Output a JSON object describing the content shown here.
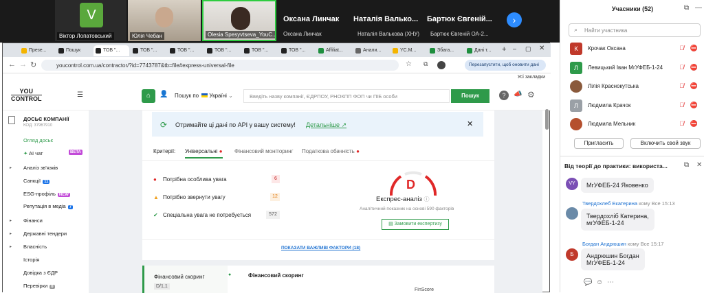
{
  "zoom": {
    "tiles": [
      {
        "initial": "V",
        "name": "Віктор Лопатовський"
      },
      {
        "name": "Юлія Чебан"
      },
      {
        "name": "Olesia Spesyvtseva_YouC..."
      }
    ],
    "name_tiles": [
      {
        "big": "Оксана Линчак",
        "small": "Оксана Линчак"
      },
      {
        "big": "Наталія Валько...",
        "small": "Наталія Валькова (ХНУ)"
      },
      {
        "big": "Бартюк Євгеній...",
        "small": "Бартюк Євгеній ОА-2..."
      }
    ],
    "next_icon": "chevron-right-icon"
  },
  "browser": {
    "tabs": [
      "Презе...",
      "Пошук",
      "ТОВ \"...",
      "ТОВ \"...",
      "ТОВ \"...",
      "ТОВ \"...",
      "ТОВ \"...",
      "ТОВ \"...",
      "Affiliat...",
      "Анали...",
      "YC.M...",
      "Збага...",
      "Дані т..."
    ],
    "url": "youcontrol.com.ua/contractor/?id=7743787&tb=file#express-universal-file",
    "restart_label": "Перезапустити, щоб оновити дані",
    "bookmarks_label": "Усі закладки"
  },
  "site": {
    "logo_line1": "YOU",
    "logo_line2": "CONTROL",
    "search_scope": "Пошук по",
    "country": "Україні",
    "search_placeholder": "Введіть назву компанії, ЄДРПОУ, РНОКПП ФОП чи ПІБ особи",
    "search_button": "Пошук"
  },
  "sidebar": {
    "dossier_title": "ДОСЬЄ КОМПАНІЇ",
    "dossier_code": "КОД: 37967910",
    "items": [
      {
        "label": "Огляд досьє"
      },
      {
        "label": "AI чат",
        "badge": "BETA"
      },
      {
        "label": "Аналіз зв'язків"
      },
      {
        "label": "Санкції",
        "badge": "11"
      },
      {
        "label": "ESG-профіль",
        "badge": "NEW"
      },
      {
        "label": "Репутація в медіа",
        "badge": "7"
      },
      {
        "label": "Фінанси"
      },
      {
        "label": "Державні тендери"
      },
      {
        "label": "Власність"
      },
      {
        "label": "Історія"
      },
      {
        "label": "Довідка з ЄДР"
      },
      {
        "label": "Перевірки",
        "badge": "0"
      }
    ]
  },
  "main": {
    "api_banner": "Отримайте ці дані по API у вашу систему!",
    "api_link": "Детальніше",
    "criteria_label": "Критерії:",
    "tabs": [
      "Універсальні",
      "Фінансовий моніторинг",
      "Податкова обачність"
    ],
    "factors": [
      {
        "label": "Потрібна особлива увага",
        "count": "6"
      },
      {
        "label": "Потрібно звернути увагу",
        "count": "12"
      },
      {
        "label": "Спеціальна увага не потребується",
        "count": "572"
      }
    ],
    "grade": "D",
    "express_title": "Експрес-аналіз",
    "express_sub": "Аналітичний показник на основі 590 факторів",
    "order_button": "Замовити експертизу",
    "show_factors": "ПОКАЗАТИ ВАЖЛИВІ ФАКТОРИ (18)",
    "scoring_left": "Фінансовий скоринг",
    "scoring_score": "D/1,1",
    "scoring_right": "Фінансовий скоринг",
    "finscore": "FinScore"
  },
  "participants": {
    "title": "Учасники (52)",
    "search_placeholder": "Найти участника",
    "list": [
      {
        "initial": "К",
        "name": "Крочак Оксана",
        "color": "#c0392b"
      },
      {
        "initial": "Л",
        "name": "Левицький Іван МгУФЕБ-1-24",
        "color": "#2e9a4a"
      },
      {
        "initial": "",
        "name": "Лілія Краснокутська",
        "color": "#8a5a3c"
      },
      {
        "initial": "Л",
        "name": "Людмила Крачок",
        "color": "#9aa0a6"
      },
      {
        "initial": "",
        "name": "Людмила Мельник",
        "color": "#b5502e"
      }
    ],
    "invite": "Пригласить",
    "unmute": "Включить свой звук"
  },
  "chat": {
    "title": "Від теорії до практики: використа...",
    "messages": [
      {
        "avatar": "VY",
        "from": "",
        "to": "",
        "time": "",
        "text": "МгУФЕБ-24 Яковенко",
        "color": "#7b4fb5"
      },
      {
        "avatar": "",
        "from": "Твердохлеб Екатерина",
        "to": "кому Все",
        "time": "15:13",
        "text": "Твердохліб Катерина,\nмгУФЕБ-1-24",
        "color": "#6a8aa8"
      },
      {
        "avatar": "Б",
        "from": "Богдан Андрюшин",
        "to": "кому Все",
        "time": "15:17",
        "text": "Андрюшин Богдан\nМгУФЕБ-1-24",
        "color": "#c0392b"
      }
    ]
  }
}
